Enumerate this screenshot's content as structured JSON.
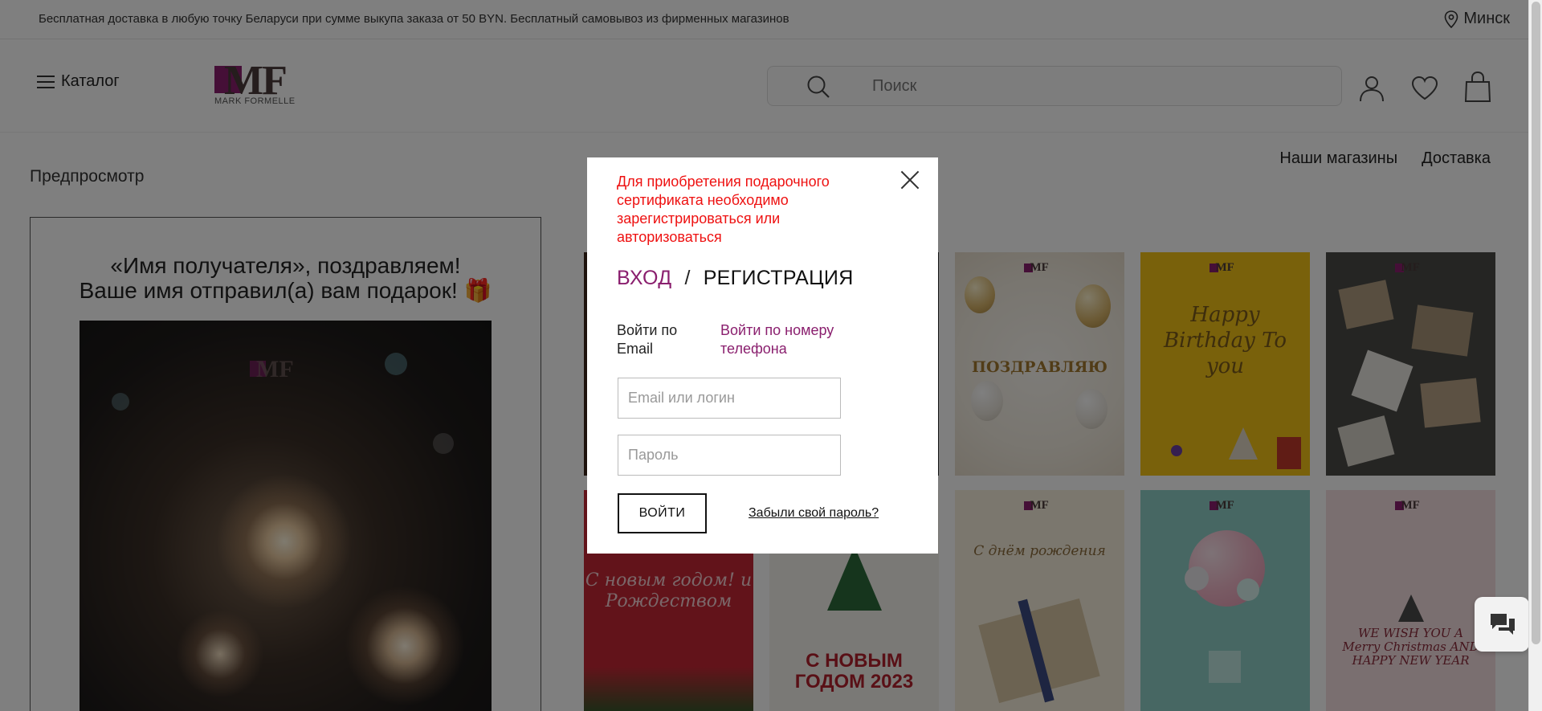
{
  "topbar": {
    "delivery_text": "Бесплатная доставка в любую точку Беларуси при сумме выкупа заказа от 50 BYN. Бесплатный самовывоз из фирменных магазинов",
    "city": "Минск"
  },
  "header": {
    "catalog_label": "Каталог",
    "logo_text": "MF",
    "logo_subtext": "MARK FORMELLE",
    "search_placeholder": "Поиск",
    "icons": [
      "search-icon",
      "user-icon",
      "heart-icon",
      "bag-icon"
    ]
  },
  "nav": {
    "stores": "Наши магазины",
    "delivery": "Доставка"
  },
  "preview": {
    "title": "Предпросмотр",
    "greeting_line1": "«Имя получателя», поздравляем!",
    "greeting_line2": "Ваше имя отправил(а) вам подарок! 🎁"
  },
  "cards": [
    {
      "text": "ПОЗДРАВЛЯЮ"
    },
    {
      "text": "Happy Birthday To you"
    },
    {
      "text": ""
    },
    {
      "text": "С новым годом! и Рождеством"
    },
    {
      "text": "С НОВЫМ ГОДОМ 2023"
    },
    {
      "text": "С днём рождения"
    },
    {
      "text": ""
    },
    {
      "text": "WE WISH YOU A Merry Christmas AND HAPPY NEW YEAR"
    }
  ],
  "modal": {
    "notice": "Для приобретения подарочного сертификата необходимо зарегистрироваться или авторизоваться",
    "tab_login": "ВХОД",
    "tab_separator": "/",
    "tab_register": "РЕГИСТРАЦИЯ",
    "method_email": "Войти по Email",
    "method_phone": "Войти по номеру телефона",
    "email_placeholder": "Email или логин",
    "password_placeholder": "Пароль",
    "submit_label": "ВОЙТИ",
    "forgot_label": "Забыли свой пароль?"
  },
  "colors": {
    "brand": "#8a1f6e",
    "notice": "#e11111",
    "overlay": "rgba(0,0,0,0.5)"
  }
}
